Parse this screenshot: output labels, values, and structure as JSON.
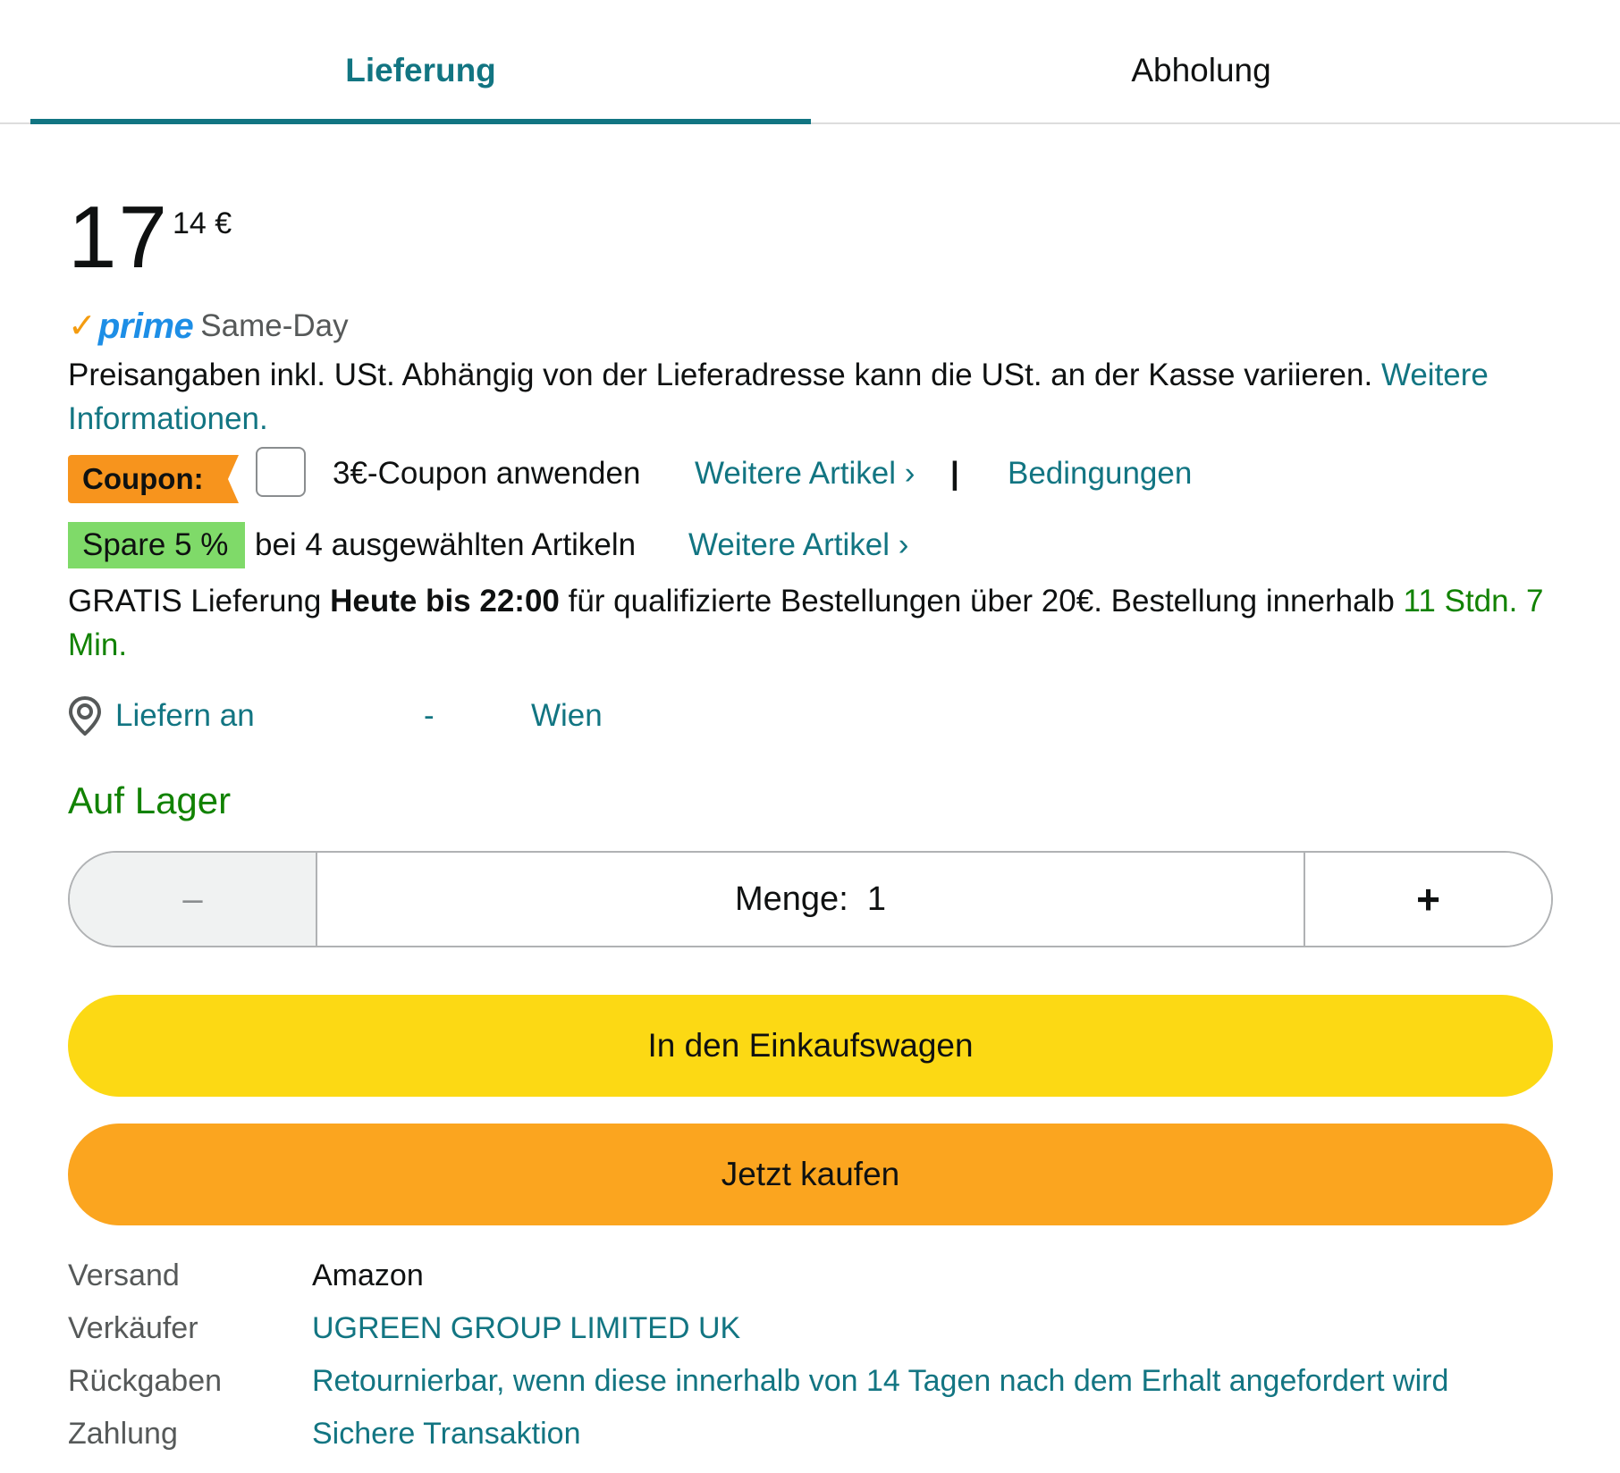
{
  "tabs": {
    "delivery": "Lieferung",
    "pickup": "Abholung"
  },
  "price": {
    "whole": "17",
    "fraction": "14 €"
  },
  "prime": {
    "check": "✓",
    "logo": "prime",
    "label": "Same-Day"
  },
  "vat": {
    "text": "Preisangaben inkl. USt. Abhängig von der Lieferadresse kann die USt. an der Kasse variieren. ",
    "link": "Weitere Informationen."
  },
  "coupon": {
    "badge": "Coupon:",
    "label": "3€-Coupon anwenden",
    "more_link": "Weitere Artikel ›",
    "separator": "|",
    "terms_link": "Bedingungen",
    "checked": false
  },
  "savings": {
    "badge": "Spare 5 %",
    "text": "bei 4 ausgewählten Artikeln",
    "more_link": "Weitere Artikel ›"
  },
  "delivery": {
    "prefix": "GRATIS Lieferung ",
    "bold": "Heute bis 22:00",
    "middle": " für qualifizierte Bestellungen über 20€. Bestellung innerhalb ",
    "countdown": "11 Stdn. 7 Min."
  },
  "deliver_to": {
    "label": "Liefern an",
    "dash": "-",
    "city": "Wien"
  },
  "stock": "Auf Lager",
  "quantity": {
    "minus": "–",
    "label": "Menge:  1",
    "plus": "+"
  },
  "buttons": {
    "add_to_cart": "In den Einkaufswagen",
    "buy_now": "Jetzt kaufen"
  },
  "details": [
    {
      "key": "Versand",
      "value": "Amazon"
    },
    {
      "key": "Verkäufer",
      "value": "UGREEN GROUP LIMITED UK"
    },
    {
      "key": "Rückgaben",
      "value": "Retournierbar, wenn diese innerhalb von 14 Tagen nach dem Erhalt angefordert wird"
    },
    {
      "key": "Zahlung",
      "value": "Sichere Transaktion"
    }
  ],
  "colors": {
    "link": "#127582",
    "green": "#118200",
    "cart_button": "#fcd914",
    "buy_button": "#fba51f",
    "coupon_badge": "#f7941d",
    "savings_badge": "#7fda69",
    "prime_blue": "#1d8ee6",
    "prime_check": "#f49c10"
  },
  "icons": {
    "location": "location-pin-icon"
  }
}
